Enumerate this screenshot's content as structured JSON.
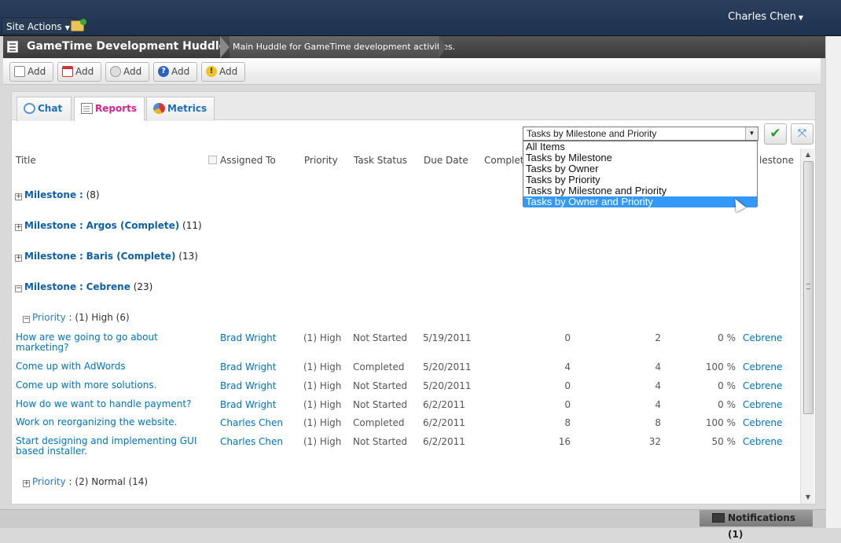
{
  "topbar": {
    "site_actions": "Site Actions",
    "user_name": "Charles Chen"
  },
  "titlebar": {
    "site_title": "GameTime Development Huddle",
    "site_description": "Main Huddle for GameTime development activities."
  },
  "toolbar": {
    "buttons": [
      {
        "label": "Add",
        "icon": "document-add-icon"
      },
      {
        "label": "Add",
        "icon": "calendar-add-icon"
      },
      {
        "label": "Add",
        "icon": "link-add-icon"
      },
      {
        "label": "Add",
        "icon": "help-add-icon"
      },
      {
        "label": "Add",
        "icon": "warning-add-icon"
      }
    ]
  },
  "tabs": [
    {
      "label": "Chat",
      "icon": "chat-icon",
      "active": false
    },
    {
      "label": "Reports",
      "icon": "report-icon",
      "active": true
    },
    {
      "label": "Metrics",
      "icon": "metrics-icon",
      "active": false
    }
  ],
  "view_select": {
    "selected": "Tasks by Milestone and Priority",
    "options": [
      "All Items",
      "Tasks by Milestone",
      "Tasks by Owner",
      "Tasks by Priority",
      "Tasks by Milestone and Priority",
      "Tasks by Owner and Priority"
    ],
    "highlighted": "Tasks by Owner and Priority"
  },
  "grid": {
    "columns": {
      "title": "Title",
      "assigned": "Assigned To",
      "priority": "Priority",
      "status": "Task Status",
      "due": "Due Date",
      "complete": "Complete",
      "milestone": "lestone"
    },
    "groups": [
      {
        "label": "Milestone",
        "sep": ":",
        "value": "",
        "count": "(8)",
        "expander": "+"
      },
      {
        "label": "Milestone",
        "sep": ":",
        "value": "Argos (Complete)",
        "count": "(11)",
        "expander": "+"
      },
      {
        "label": "Milestone",
        "sep": ":",
        "value": "Baris (Complete)",
        "count": "(13)",
        "expander": "+"
      },
      {
        "label": "Milestone",
        "sep": ":",
        "value": "Cebrene",
        "count": "(23)",
        "expander": "−"
      }
    ],
    "subgroups": [
      {
        "label": "Priority",
        "sep": ":",
        "value": "(1) High",
        "count": "(6)",
        "expander": "−"
      },
      {
        "label": "Priority",
        "sep": ":",
        "value": "(2) Normal",
        "count": "(14)",
        "expander": "+"
      }
    ],
    "rows": [
      {
        "title": "How are we going to go about marketing?",
        "assigned": "Brad Wright",
        "priority": "(1) High",
        "status": "Not Started",
        "due": "5/19/2011",
        "n1": "0",
        "n2": "2",
        "pct": "0 %",
        "milestone": "Cebrene"
      },
      {
        "title": "Come up with AdWords",
        "assigned": "Brad Wright",
        "priority": "(1) High",
        "status": "Completed",
        "due": "5/20/2011",
        "n1": "4",
        "n2": "4",
        "pct": "100 %",
        "milestone": "Cebrene"
      },
      {
        "title": "Come up with more solutions.",
        "assigned": "Brad Wright",
        "priority": "(1) High",
        "status": "Not Started",
        "due": "5/20/2011",
        "n1": "0",
        "n2": "4",
        "pct": "0 %",
        "milestone": "Cebrene"
      },
      {
        "title": "How do we want to handle payment?",
        "assigned": "Brad Wright",
        "priority": "(1) High",
        "status": "Not Started",
        "due": "6/2/2011",
        "n1": "0",
        "n2": "4",
        "pct": "0 %",
        "milestone": "Cebrene"
      },
      {
        "title": "Work on reorganizing the website.",
        "assigned": "Charles Chen",
        "priority": "(1) High",
        "status": "Completed",
        "due": "6/2/2011",
        "n1": "8",
        "n2": "8",
        "pct": "100 %",
        "milestone": "Cebrene"
      },
      {
        "title": "Start designing and implementing GUI based installer.",
        "assigned": "Charles Chen",
        "priority": "(1) High",
        "status": "Not Started",
        "due": "6/2/2011",
        "n1": "16",
        "n2": "32",
        "pct": "50 %",
        "milestone": "Cebrene"
      }
    ]
  },
  "statusbar": {
    "notifications": "Notifications (1)"
  }
}
